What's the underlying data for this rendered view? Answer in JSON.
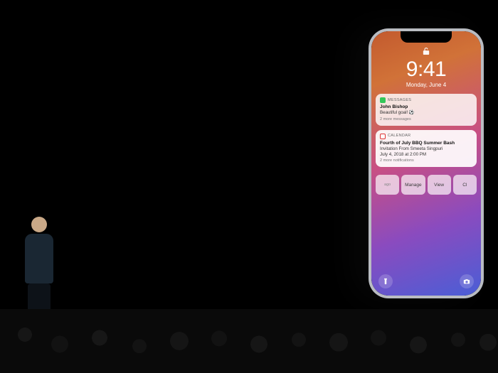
{
  "lockscreen": {
    "time": "9:41",
    "date": "Monday, June 4"
  },
  "notifications": {
    "messages": {
      "app_label": "MESSAGES",
      "sender": "John Bishop",
      "body": "Beautiful goal! ⚽",
      "more": "2 more messages"
    },
    "calendar": {
      "app_label": "CALENDAR",
      "title": "Fourth of July BBQ Summer Bash",
      "subtitle": "Invitation From Smeeta Singpuri",
      "detail": "July 4, 2018 at 2:00 PM",
      "more": "2 more notifications"
    }
  },
  "action_row": {
    "hint": "ago",
    "manage": "Manage",
    "view": "View",
    "clear": "Cl"
  },
  "icons": {
    "lock": "unlock-icon",
    "flashlight": "flashlight-icon",
    "camera": "camera-icon"
  }
}
